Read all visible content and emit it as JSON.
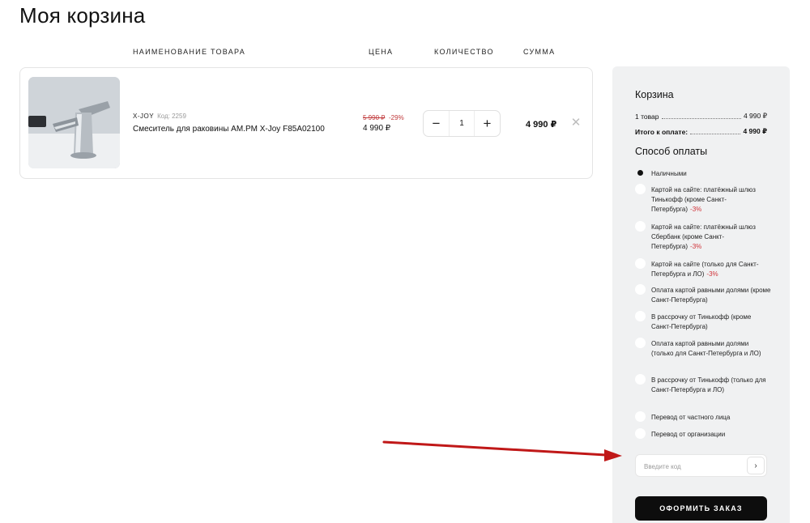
{
  "page": {
    "title": "Моя корзина"
  },
  "table_headers": {
    "name": "НАИМЕНОВАНИЕ ТОВАРА",
    "price": "ЦЕНА",
    "quantity": "КОЛИЧЕСТВО",
    "sum": "СУММА"
  },
  "cart_item": {
    "brand": "X-JOY",
    "code": "Код: 2259",
    "name": "Смеситель для раковины AM.PM X-Joy F85A02100",
    "old_price": "5 990 ₽",
    "discount": "-29%",
    "price": "4 990 ₽",
    "quantity": "1",
    "sum": "4 990 ₽",
    "remove_icon": "close-icon"
  },
  "summary": {
    "title": "Корзина",
    "items_label": "1 товар",
    "items_value": "4 990 ₽",
    "total_label": "Итого к оплате:",
    "total_value": "4 990 ₽"
  },
  "payment": {
    "title": "Способ оплаты",
    "selected_index": 0,
    "options": [
      {
        "label": "Наличными",
        "discount": ""
      },
      {
        "label": "Картой на сайте: платёжный шлюз Тинькофф (кроме Санкт-Петербурга)",
        "discount": "-3%"
      },
      {
        "label": "Картой на сайте: платёжный шлюз Сбербанк (кроме Санкт-Петербурга)",
        "discount": "-3%"
      },
      {
        "label": "Картой на сайте (только для Санкт-Петербурга и ЛО)",
        "discount": "-3%"
      },
      {
        "label": "Оплата картой равными долями (кроме Санкт-Петербурга)",
        "discount": ""
      },
      {
        "label": "В рассрочку от Тинькофф (кроме Санкт-Петербурга)",
        "discount": ""
      },
      {
        "label": "Оплата картой равными долями (только для Санкт-Петербурга и ЛО)",
        "discount": ""
      },
      {
        "label": "В рассрочку от Тинькофф (только для Санкт-Петербурга и ЛО)",
        "discount": ""
      },
      {
        "label": "Перевод от частного лица",
        "discount": ""
      },
      {
        "label": "Перевод от организации",
        "discount": ""
      }
    ]
  },
  "promo": {
    "placeholder": "Введите код",
    "button": "›"
  },
  "checkout": {
    "label": "ОФОРМИТЬ ЗАКАЗ"
  },
  "colors": {
    "accent": "#0d0d0d",
    "discount": "#c0393b",
    "arrow": "#c01818",
    "sidebar_bg": "#f0f1f2"
  }
}
